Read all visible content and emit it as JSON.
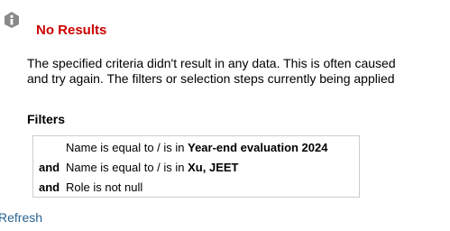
{
  "notice": {
    "icon": "info-icon",
    "title": "No Results",
    "title_color": "#cc0000",
    "message_line1": "The specified criteria didn't result in any data. This is often caused",
    "message_line2": "and try again. The filters or selection steps currently being applied"
  },
  "filters": {
    "heading": "Filters",
    "rows": [
      {
        "conjunction": "",
        "condition": "Name is equal to / is in ",
        "value": "Year-end evaluation 2024"
      },
      {
        "conjunction": "and",
        "condition": "Name is equal to / is in ",
        "value": "Xu, JEET"
      },
      {
        "conjunction": "and",
        "condition": "Role is not null",
        "value": ""
      }
    ]
  },
  "actions": {
    "refresh_label": "Refresh",
    "link_color": "#2a6496"
  }
}
